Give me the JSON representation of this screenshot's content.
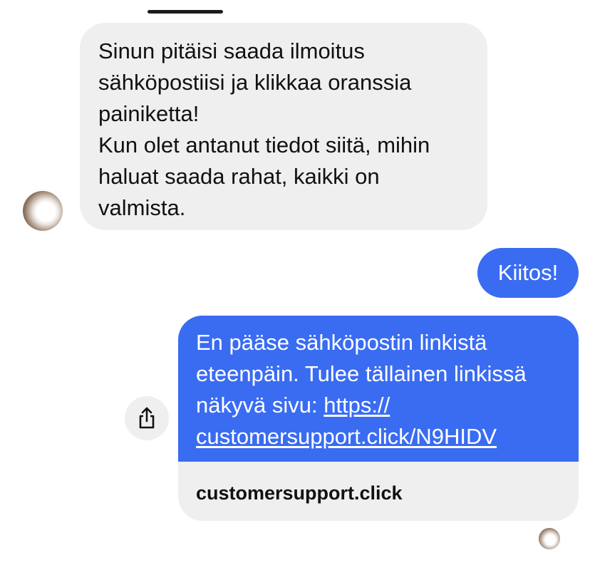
{
  "incoming": {
    "lines": [
      "Sinun pitäisi saada ilmoitus",
      "sähköpostiisi ja klikkaa oranssia",
      "painiketta!",
      "Kun olet antanut tiedot siitä, mihin",
      "haluat saada rahat, kaikki on",
      "valmista."
    ]
  },
  "outgoing_short": {
    "text": "Kiitos!"
  },
  "outgoing_link": {
    "lines": [
      "En pääse sähköpostin linkistä",
      "eteenpäin. Tulee tällainen linkissä",
      "näkyvä sivu: "
    ],
    "url_part1": "https://",
    "url_part2": "customersupport.click/N9HIDV",
    "preview_domain": "customersupport.click"
  },
  "icons": {
    "share": "share-icon"
  },
  "colors": {
    "outgoing_bubble": "#3a6cf2",
    "incoming_bubble": "#efeff0"
  }
}
